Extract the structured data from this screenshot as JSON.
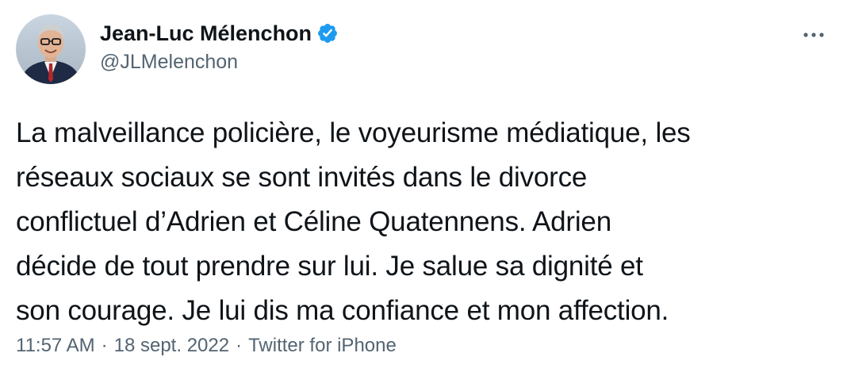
{
  "author": {
    "display_name": "Jean-Luc Mélenchon",
    "handle": "@JLMelenchon",
    "verified": true,
    "verified_badge_color": "#1d9bf0",
    "avatar_icon": "avatar-photo"
  },
  "tweet": {
    "text": "La malveillance policière, le voyeurisme médiatique, les\nréseaux sociaux se sont invités dans le divorce\nconflictuel d’Adrien et Céline Quatennens. Adrien\ndécide de tout prendre sur lui. Je salue sa dignité et\nson courage. Je lui dis ma confiance et mon affection."
  },
  "meta": {
    "time": "11:57 AM",
    "separator": "·",
    "date": "18 sept. 2022",
    "source": "Twitter for iPhone"
  },
  "menu": {
    "icon": "more-horizontal-icon"
  },
  "colors": {
    "text": "#0f1419",
    "secondary": "#536471",
    "accent": "#1d9bf0"
  }
}
